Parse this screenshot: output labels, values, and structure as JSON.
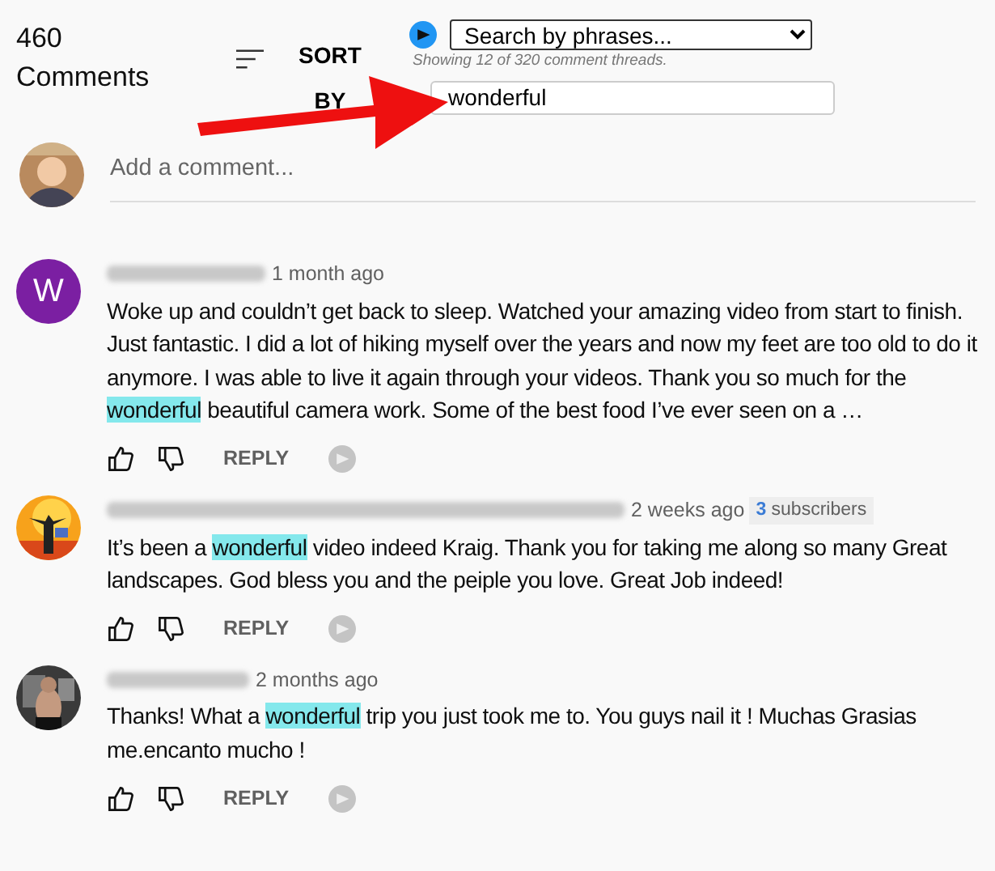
{
  "header": {
    "count": "460",
    "count_label": "Comments",
    "sort_label": "SORT BY"
  },
  "filter": {
    "select_value": "Search by phrases...",
    "note": "Showing 12 of 320 comment threads.",
    "search_value": "wonderful"
  },
  "add_comment": {
    "placeholder": "Add a comment..."
  },
  "comments": [
    {
      "avatar": {
        "kind": "letter",
        "letter": "W"
      },
      "time": "1 month ago",
      "segments": [
        {
          "text": "Woke up and couldn’t get back to sleep. Watched your amazing video from start to finish. Just fantastic. I did a lot of hiking myself over the years and now my feet are too old to do it anymore. I was able to live it again through your videos. Thank you so much for the ",
          "highlighted": false
        },
        {
          "text": "wonderful",
          "highlighted": true
        },
        {
          "text": " beautiful camera work. Some of the best food I’ve ever seen on a …",
          "highlighted": false
        }
      ],
      "reply": "REPLY"
    },
    {
      "time": "2 weeks ago",
      "badge": {
        "count": "3",
        "label": "subscribers"
      },
      "segments": [
        {
          "text": "It’s been a ",
          "highlighted": false
        },
        {
          "text": "wonderful",
          "highlighted": true
        },
        {
          "text": " video indeed Kraig. Thank you for taking me along so many Great landscapes. God bless you and the peiple you love. Great Job indeed!",
          "highlighted": false
        }
      ],
      "reply": "REPLY"
    },
    {
      "time": "2 months ago",
      "segments": [
        {
          "text": "Thanks! What a ",
          "highlighted": false
        },
        {
          "text": "wonderful",
          "highlighted": true
        },
        {
          "text": " trip you just took me to.  You guys nail it ! Muchas Grasias me.encanto mucho !",
          "highlighted": false
        }
      ],
      "reply": "REPLY"
    }
  ]
}
